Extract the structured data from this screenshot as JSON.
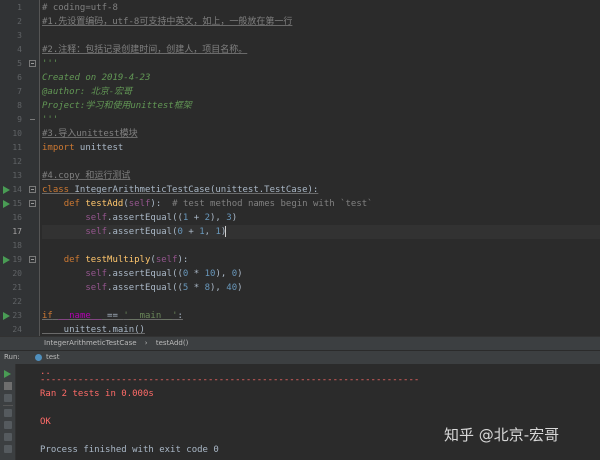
{
  "editor": {
    "lines": [
      {
        "n": "1",
        "html": "<span class='cm'># coding=utf-8</span>"
      },
      {
        "n": "2",
        "html": "<span class='cmu'>#1.先设置编码，utf-8可支持中英文，如上，一般放在第一行</span>"
      },
      {
        "n": "3",
        "html": ""
      },
      {
        "n": "4",
        "html": "<span class='cmu'>#2.注释：包括记录创建时间，创建人，项目名称。</span>"
      },
      {
        "n": "5",
        "html": "<span class='doc'>'''</span>"
      },
      {
        "n": "6",
        "html": "<span class='doc'>Created on 2019-4-23</span>"
      },
      {
        "n": "7",
        "html": "<span class='doc'>@author: 北京-宏哥</span>"
      },
      {
        "n": "8",
        "html": "<span class='doc'>Project:学习和使用unittest框架</span>"
      },
      {
        "n": "9",
        "html": "<span class='doc'>'''</span>"
      },
      {
        "n": "10",
        "html": "<span class='cmu'>#3.导入unittest模块</span>"
      },
      {
        "n": "11",
        "html": "<span class='kw'>import</span> unittest"
      },
      {
        "n": "12",
        "html": ""
      },
      {
        "n": "13",
        "html": "<span class='cmu'>#4.copy 和运行测试</span>"
      },
      {
        "n": "14",
        "html": "<span class='kw u'>class</span><span class='u'> IntegerArithmeticTestCase(unittest.TestCase):</span>"
      },
      {
        "n": "15",
        "html": "    <span class='kw'>def</span> <span class='fn'>testAdd</span>(<span class='self'>self</span>):  <span class='cm'># test method names begin with `test`</span>"
      },
      {
        "n": "16",
        "html": "        <span class='self'>self</span>.assertEqual((<span class='num'>1</span> + <span class='num'>2</span>), <span class='num'>3</span>)"
      },
      {
        "n": "17",
        "html": "        <span class='self'>self</span>.assertEqual(<span class='num'>0</span> + <span class='num'>1</span>, <span class='num'>1</span>)<span class='caret'></span>"
      },
      {
        "n": "18",
        "html": ""
      },
      {
        "n": "19",
        "html": "    <span class='kw'>def</span> <span class='fn'>testMultiply</span>(<span class='self'>self</span>):"
      },
      {
        "n": "20",
        "html": "        <span class='self'>self</span>.assertEqual((<span class='num'>0</span> * <span class='num'>10</span>), <span class='num'>0</span>)"
      },
      {
        "n": "21",
        "html": "        <span class='self'>self</span>.assertEqual((<span class='num'>5</span> * <span class='num'>8</span>), <span class='num'>40</span>)"
      },
      {
        "n": "22",
        "html": ""
      },
      {
        "n": "23",
        "html": "<span class='kw u'>if</span><span class='u'> </span><span class='dunder u'>__name__</span><span class='u'> == </span><span class='str u'>'__main__'</span><span class='u'>:</span>"
      },
      {
        "n": "24",
        "html": "<span class='u'>    unittest.main()</span>"
      }
    ]
  },
  "breadcrumb": {
    "class_name": "IntegerArithmeticTestCase",
    "separator": "›",
    "method_name": "testAdd()"
  },
  "run_panel": {
    "label": "Run:",
    "tab_name": "test"
  },
  "console": {
    "line1": "..",
    "line2": "----------------------------------------------------------------------",
    "line3": "Ran 2 tests in 0.000s",
    "line4": "OK",
    "line5": "Process finished with exit code 0"
  },
  "watermark": "知乎 @北京-宏哥",
  "colors": {
    "editor_bg": "#2b2b2b",
    "gutter_bg": "#313335",
    "keyword": "#cc7832",
    "function": "#ffc66d",
    "number": "#6897bb",
    "comment": "#808080",
    "docstring": "#629755",
    "self": "#94558d",
    "stderr": "#ff6b68",
    "run_green": "#499c54"
  }
}
